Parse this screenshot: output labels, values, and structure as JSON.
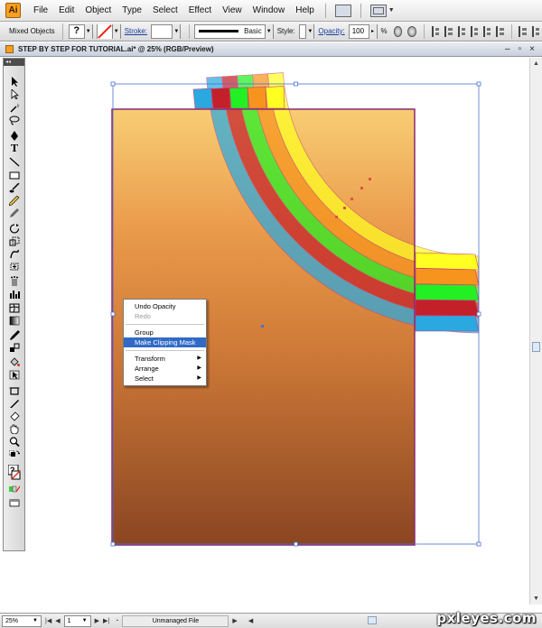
{
  "menubar": {
    "logo": "Ai",
    "items": [
      "File",
      "Edit",
      "Object",
      "Type",
      "Select",
      "Effect",
      "View",
      "Window",
      "Help"
    ]
  },
  "controlbar": {
    "selection_label": "Mixed Objects",
    "fill_swatch": "?",
    "stroke_label": "Stroke:",
    "brush_label": "Basic",
    "style_label": "Style:",
    "opacity_label": "Opacity:",
    "opacity_value": "100",
    "opacity_unit": "%"
  },
  "document": {
    "title": "STEP BY STEP FOR TUTORIAL.ai* @ 25% (RGB/Preview)",
    "controls": [
      "–",
      "▫",
      "×"
    ],
    "toolbox_grip": "◂◂"
  },
  "context_menu": {
    "items": [
      {
        "label": "Undo Opacity",
        "state": "normal",
        "submenu": false
      },
      {
        "label": "Redo",
        "state": "disabled",
        "submenu": false
      },
      {
        "separator": true
      },
      {
        "label": "Group",
        "state": "normal",
        "submenu": false
      },
      {
        "label": "Make Clipping Mask",
        "state": "highlighted",
        "submenu": false
      },
      {
        "separator": true
      },
      {
        "label": "Transform",
        "state": "normal",
        "submenu": true
      },
      {
        "label": "Arrange",
        "state": "normal",
        "submenu": true
      },
      {
        "label": "Select",
        "state": "normal",
        "submenu": true
      }
    ]
  },
  "statusbar": {
    "zoom": "25%",
    "page": "1",
    "status_text": "Unmanaged File"
  },
  "artwork": {
    "bands": [
      "#ffff22",
      "#f7941d",
      "#22f022",
      "#c4202a",
      "#2aa9e0"
    ],
    "selection_color": "#4a72d0",
    "artboard_color": "#b0307a"
  },
  "watermark": "pxleyes.com"
}
